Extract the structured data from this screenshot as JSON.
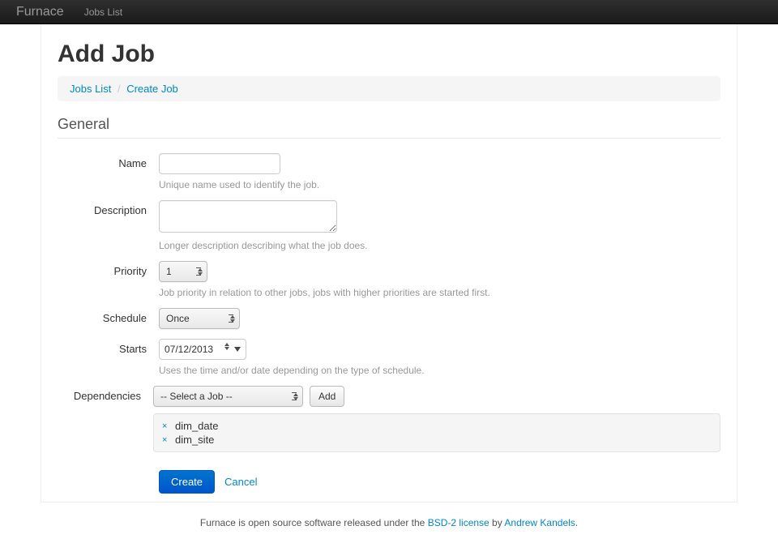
{
  "nav": {
    "brand": "Furnace",
    "link1": "Jobs List"
  },
  "page": {
    "title": "Add Job"
  },
  "breadcrumb": {
    "item1": "Jobs List",
    "item2": "Create Job"
  },
  "section": {
    "title": "General"
  },
  "form": {
    "name": {
      "label": "Name",
      "value": "",
      "help": "Unique name used to identify the job."
    },
    "description": {
      "label": "Description",
      "value": "",
      "help": "Longer description describing what the job does."
    },
    "priority": {
      "label": "Priority",
      "value": "1",
      "help": "Job priority in relation to other jobs, jobs with higher priorities are started first."
    },
    "schedule": {
      "label": "Schedule",
      "value": "Once"
    },
    "starts": {
      "label": "Starts",
      "value": "07/12/2013",
      "help": "Uses the time and/or date depending on the type of schedule."
    },
    "dependencies": {
      "label": "Dependencies",
      "placeholder": "-- Select a Job --",
      "add_label": "Add",
      "items": [
        {
          "name": "dim_date"
        },
        {
          "name": "dim_site"
        }
      ]
    }
  },
  "actions": {
    "create": "Create",
    "cancel": "Cancel"
  },
  "footer": {
    "t1": "Furnace is open source software released under the ",
    "l1": "BSD-2 license",
    "t2": " by ",
    "l2": "Andrew Kandels",
    "t3": "."
  }
}
